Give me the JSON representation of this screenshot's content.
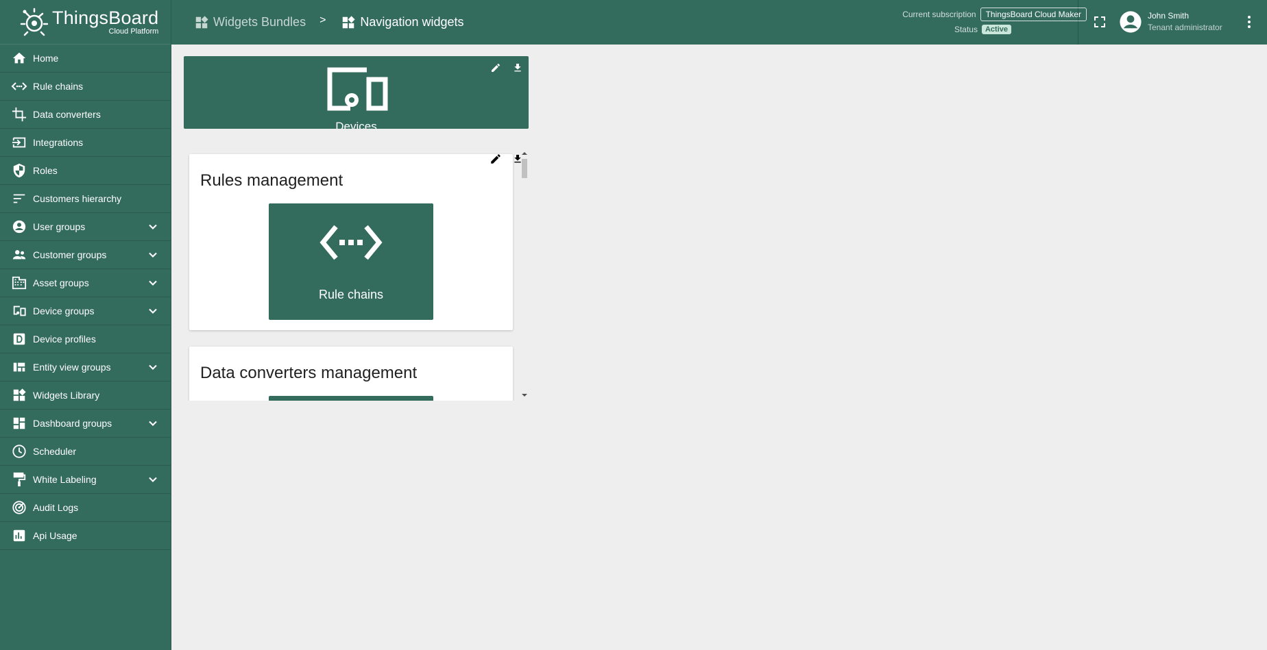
{
  "colors": {
    "brand": "#336b5c",
    "background": "#eeeeee",
    "status_active_bg": "#c8e6d9"
  },
  "logo": {
    "title": "ThingsBoard",
    "subtitle": "Cloud Platform"
  },
  "sidebar": {
    "items": [
      {
        "label": "Home",
        "icon": "home-icon",
        "expandable": false
      },
      {
        "label": "Rule chains",
        "icon": "rule-chains-icon",
        "expandable": false
      },
      {
        "label": "Data converters",
        "icon": "crop-icon",
        "expandable": false
      },
      {
        "label": "Integrations",
        "icon": "input-icon",
        "expandable": false
      },
      {
        "label": "Roles",
        "icon": "shield-icon",
        "expandable": false
      },
      {
        "label": "Customers hierarchy",
        "icon": "sort-icon",
        "expandable": false
      },
      {
        "label": "User groups",
        "icon": "account-circle-icon",
        "expandable": true
      },
      {
        "label": "Customer groups",
        "icon": "supervisor-icon",
        "expandable": true
      },
      {
        "label": "Asset groups",
        "icon": "domain-icon",
        "expandable": true
      },
      {
        "label": "Device groups",
        "icon": "devices-icon",
        "expandable": true
      },
      {
        "label": "Device profiles",
        "icon": "device-profile-icon",
        "expandable": false
      },
      {
        "label": "Entity view groups",
        "icon": "view-quilt-icon",
        "expandable": true
      },
      {
        "label": "Widgets Library",
        "icon": "widgets-icon",
        "expandable": false
      },
      {
        "label": "Dashboard groups",
        "icon": "dashboard-icon",
        "expandable": true
      },
      {
        "label": "Scheduler",
        "icon": "schedule-icon",
        "expandable": false
      },
      {
        "label": "White Labeling",
        "icon": "format-paint-icon",
        "expandable": true
      },
      {
        "label": "Audit Logs",
        "icon": "track-changes-icon",
        "expandable": false
      },
      {
        "label": "Api Usage",
        "icon": "insert-chart-icon",
        "expandable": false
      }
    ]
  },
  "header": {
    "breadcrumb": [
      {
        "label": "Widgets Bundles",
        "icon": "widgets-icon"
      },
      {
        "label": "Navigation widgets",
        "icon": "widgets-icon"
      }
    ],
    "separator": ">",
    "subscription_label": "Current subscription",
    "subscription_plan": "ThingsBoard Cloud Maker",
    "status_label": "Status",
    "status_value": "Active",
    "user_name": "John Smith",
    "user_role": "Tenant administrator"
  },
  "widgets": {
    "devices_label": "Devices",
    "rules_card_title": "Rules management",
    "rule_chains_label": "Rule chains",
    "converters_card_title": "Data converters management"
  }
}
